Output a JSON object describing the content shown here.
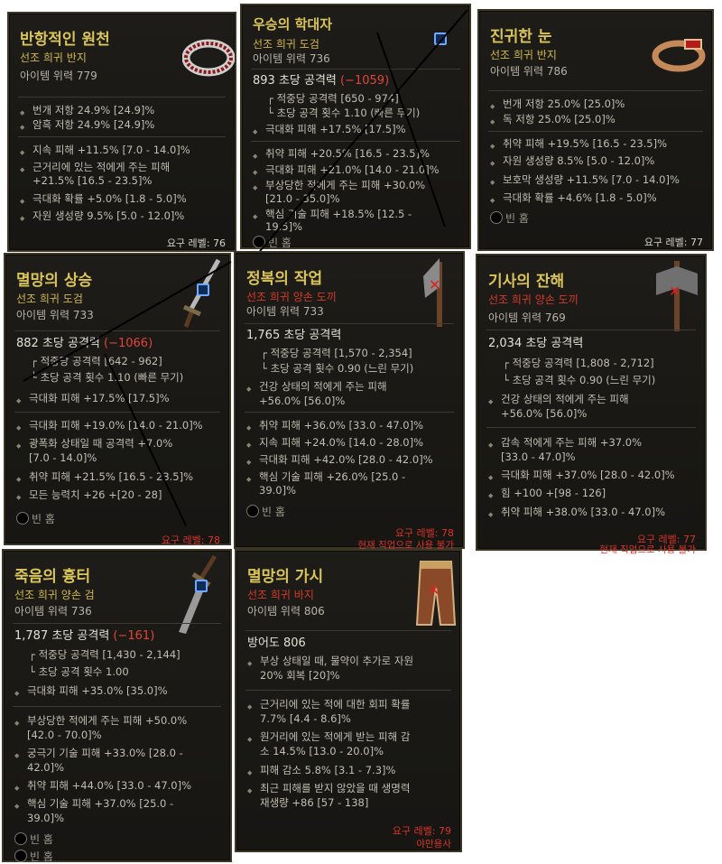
{
  "cards": [
    {
      "title": "반항적인 원천",
      "subtitle": "선조 희귀 반지",
      "power": "아이템 위력 779",
      "g1": [
        "번개 저항 24.9% [24.9]%",
        "암흑 저항 24.9% [24.9]%"
      ],
      "g2": [
        "지속 피해 +11.5% [7.0 - 14.0]%",
        "근거리에 있는 적에게 주는 피해",
        "+21.5% [16.5 - 23.5]%",
        "극대화 확률 +5.0% [1.8 - 5.0]%",
        "자원 생성량 9.5% [5.0 - 12.0]%"
      ],
      "req": "요구 레벨: 76"
    },
    {
      "title": "우승의 학대자",
      "subtitle": "선조 희귀 도검",
      "power": "아이템 위력 736",
      "damage": "893 초당 공격력",
      "damage_diff": "(−1059)",
      "stats": [
        "적중당 공격력 [650 - 974]",
        "초당 공격 횟수 1.10 (빠른 무기)"
      ],
      "implicit": "극대화 피해 +17.5% [17.5]%",
      "g2": [
        "취약 피해 +20.5% [16.5 - 23.5]%",
        "극대화 피해 +21.0% [14.0 - 21.0]%",
        "부상당한 적에게 주는 피해 +30.0%",
        "[21.0 - 35.0]%",
        "핵심 기술 피해 +18.5% [12.5 -",
        "19.5]%"
      ],
      "socket": "빈 홈"
    },
    {
      "title": "진귀한 눈",
      "subtitle": "선조 희귀 반지",
      "power": "아이템 위력 786",
      "g1": [
        "번개 저항 25.0% [25.0]%",
        "독 저항 25.0% [25.0]%"
      ],
      "g2": [
        "취약 피해 +19.5% [16.5 - 23.5]%",
        "자원 생성량 8.5% [5.0 - 12.0]%",
        "보호막 생성량 +11.5% [7.0 - 14.0]%",
        "극대화 확률 +4.6% [1.8 - 5.0]%"
      ],
      "socket": "빈 홈",
      "req": "요구 레벨: 77"
    },
    {
      "title": "멸망의 상승",
      "subtitle": "선조 희귀 도검",
      "power": "아이템 위력 733",
      "damage": "882 초당 공격력",
      "damage_diff": "(−1066)",
      "stats": [
        "적중당 공격력 [642 - 962]",
        "초당 공격 횟수 1.10 (빠른 무기)"
      ],
      "implicit": "극대화 피해 +17.5% [17.5]%",
      "g2": [
        "극대화 피해 +19.0% [14.0 - 21.0]%",
        "광폭화 상태일 때 공격력 +7.0%",
        "[7.0 - 14.0]%",
        "취약 피해 +21.5% [16.5 - 23.5]%",
        "모든 능력치 +26 +[20 - 28]"
      ],
      "socket": "빈 홈",
      "req": "요구 레벨: 78"
    },
    {
      "title": "정복의 작업",
      "subtitle": "선조 희귀 양손 도끼",
      "power": "아이템 위력 733",
      "damage": "1,765 초당 공격력",
      "stats": [
        "적중당 공격력 [1,570 - 2,354]",
        "초당 공격 횟수 0.90 (느린 무기)"
      ],
      "implicit": [
        "건강 상태의 적에게 주는 피해",
        "+56.0% [56.0]%"
      ],
      "g2": [
        "취약 피해 +36.0% [33.0 - 47.0]%",
        "지속 피해 +24.0% [14.0 - 28.0]%",
        "극대화 피해 +42.0% [28.0 - 42.0]%",
        "핵심 기술 피해 +26.0% [25.0 -",
        "39.0]%"
      ],
      "socket": "빈 홈",
      "req": "요구 레벨: 78",
      "warn": "현재 직업으로 사용 불가"
    },
    {
      "title": "기사의 잔해",
      "subtitle": "선조 희귀 양손 도끼",
      "power": "아이템 위력 769",
      "damage": "2,034 초당 공격력",
      "stats": [
        "적중당 공격력 [1,808 - 2,712]",
        "초당 공격 횟수 0.90 (느린 무기)"
      ],
      "implicit": [
        "건강 상태의 적에게 주는 피해",
        "+56.0% [56.0]%"
      ],
      "g2": [
        "감속 적에게 주는 피해 +37.0%",
        "[33.0 - 47.0]%",
        "극대화 피해 +37.0% [28.0 - 42.0]%",
        "힘 +100 +[98 - 126]",
        "취약 피해 +38.0% [33.0 - 47.0]%"
      ],
      "req": "요구 레벨: 77",
      "warn": "현재 직업으로 사용 불가"
    },
    {
      "title": "죽음의 흉터",
      "subtitle": "선조 희귀 양손 검",
      "power": "아이템 위력 736",
      "damage": "1,787 초당 공격력",
      "damage_diff": "(−161)",
      "stats": [
        "적중당 공격력 [1,430 - 2,144]",
        "초당 공격 횟수 1.00"
      ],
      "implicit": "극대화 피해 +35.0% [35.0]%",
      "g2": [
        "부상당한 적에게 주는 피해 +50.0%",
        "[42.0 - 70.0]%",
        "궁극기 기술 피해 +33.0% [28.0 -",
        "42.0]%",
        "취약 피해 +44.0% [33.0 - 47.0]%",
        "핵심 기술 피해 +37.0% [25.0 -",
        "39.0]%"
      ],
      "sockets": [
        "빈 홈",
        "빈 홈"
      ]
    },
    {
      "title": "멸망의 가시",
      "subtitle": "선조 희귀 바지",
      "power": "아이템 위력 806",
      "armor": "방어도 806",
      "implicit": [
        "부상 상태일 때, 물약이 추가로 자원",
        "20% 회복 [20]%"
      ],
      "g2": [
        "근거리에 있는 적에 대한 회피 확률",
        "7.7% [4.4 - 8.6]%",
        "원거리에 있는 적에게 받는 피해 감",
        "소 14.5% [13.0 - 20.0]%",
        "피해 감소 5.8% [3.1 - 7.3]%",
        "최근 피해를 받지 않았을 때 생명력",
        "재생량 +86 [57 - 138]"
      ],
      "req": "요구 레벨: 79",
      "warn": "야만용사"
    }
  ]
}
